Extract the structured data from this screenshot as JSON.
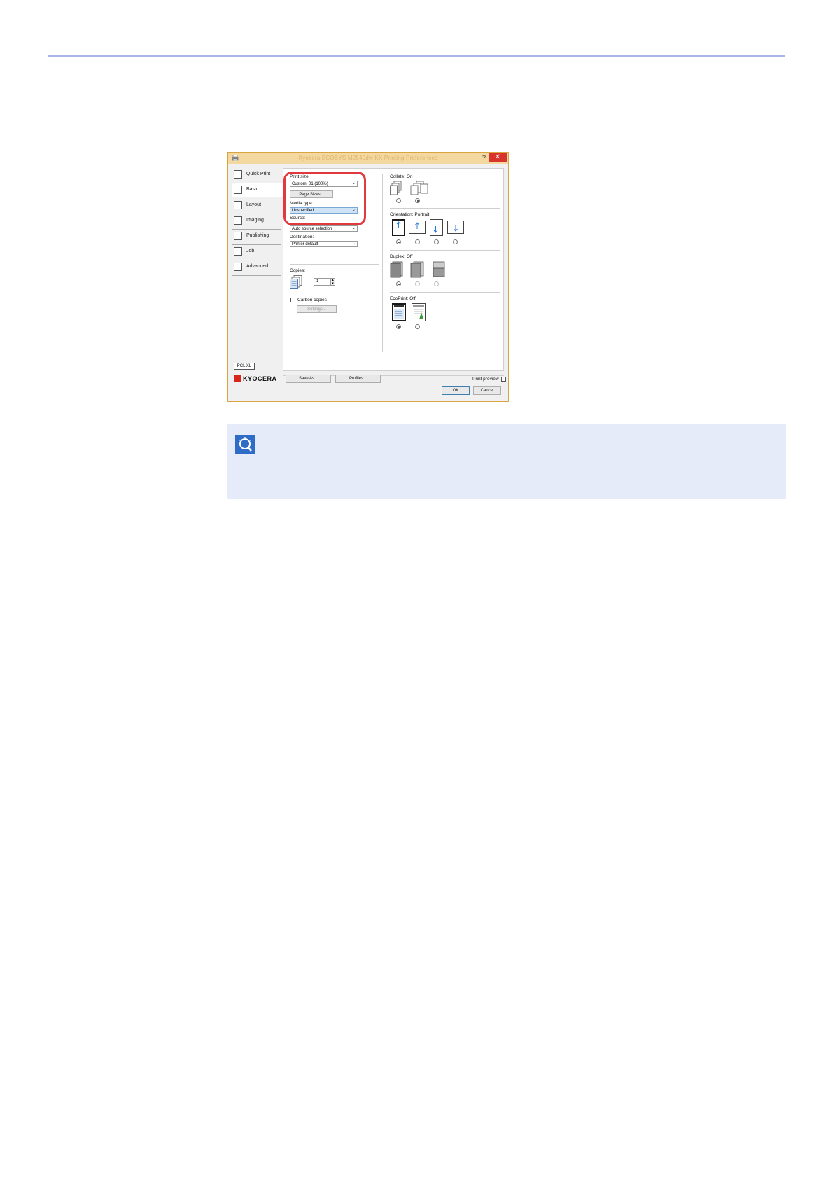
{
  "dialog": {
    "title": "Kyocera ECOSYS M2540dw KX Printing Preferences",
    "help_label": "?",
    "close_label": "✕",
    "tabs": [
      {
        "label": "Quick Print",
        "icon": "quick-print-icon"
      },
      {
        "label": "Basic",
        "icon": "basic-icon"
      },
      {
        "label": "Layout",
        "icon": "layout-icon"
      },
      {
        "label": "Imaging",
        "icon": "imaging-icon"
      },
      {
        "label": "Publishing",
        "icon": "publishing-icon"
      },
      {
        "label": "Job",
        "icon": "job-icon"
      },
      {
        "label": "Advanced",
        "icon": "advanced-icon"
      }
    ],
    "active_tab": "Basic",
    "basic": {
      "print_size_label": "Print size:",
      "print_size_value": "Custom_01 (100%)",
      "page_sizes_button": "Page Sizes...",
      "media_type_label": "Media type:",
      "media_type_value": "Unspecified",
      "source_label": "Source:",
      "source_value": "Auto source selection",
      "destination_label": "Destination:",
      "destination_value": "Printer default",
      "copies_label": "Copies:",
      "copies_value": "1",
      "carbon_copies_label": "Carbon copies",
      "settings_button": "Settings...",
      "collate_label": "Collate:  On",
      "orientation_label": "Orientation:  Portrait",
      "duplex_label": "Duplex:  Off",
      "ecoprint_label": "EcoPrint:  Off"
    },
    "footer": {
      "pcl_badge": "PCL XL",
      "save_as_button": "Save As...",
      "profiles_button": "Profiles...",
      "print_preview_label": "Print preview",
      "ok_button": "OK",
      "cancel_button": "Cancel",
      "brand": "KYOCERA"
    },
    "colors": {
      "titlebar": "#f3d8a0",
      "close": "#d9342b",
      "highlight": "#e03a3e",
      "brand_red": "#d8261c"
    }
  },
  "note": {
    "icon": "tip-icon",
    "background": "#e6ebfa"
  }
}
